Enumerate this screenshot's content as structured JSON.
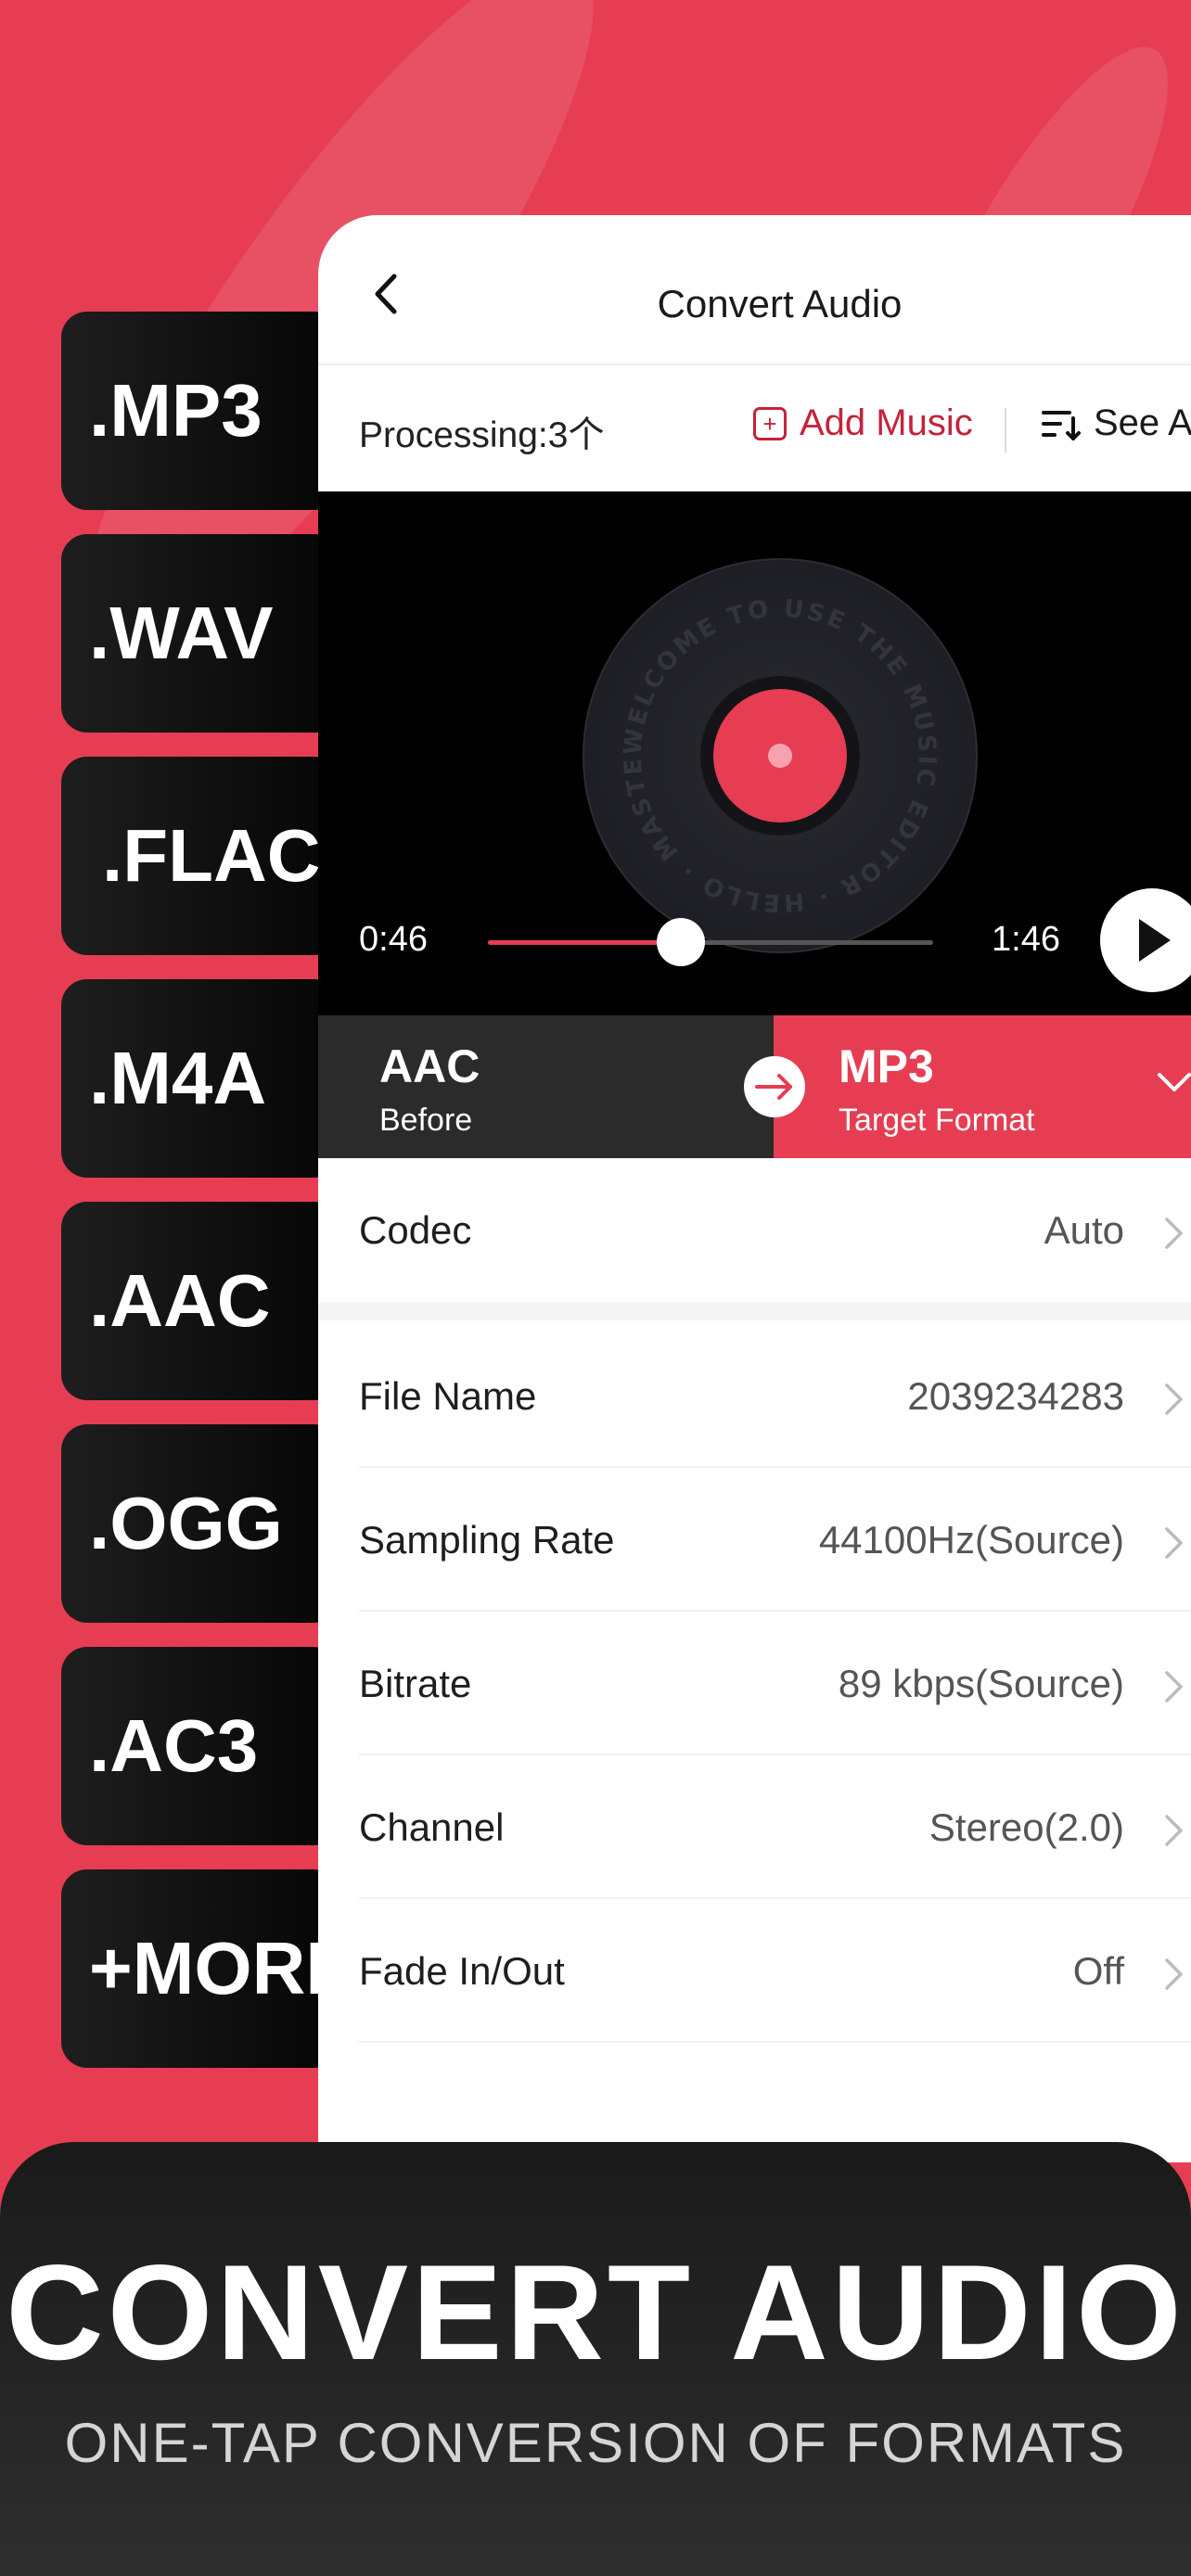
{
  "formats": [
    ".MP3",
    ".WAV",
    ".FLAC",
    ".M4A",
    ".AAC",
    ".OGG",
    ".AC3",
    "+MORE"
  ],
  "nav": {
    "title": "Convert Audio"
  },
  "toolbar": {
    "processing": "Processing:3个",
    "add_music": "Add Music",
    "see_all": "See All"
  },
  "player": {
    "disc_text": "WELCOME TO USE THE MUSIC EDITOR · HELLO · MASTER",
    "current_time": "0:46",
    "total_time": "1:46",
    "progress_fraction": 0.434
  },
  "format_bar": {
    "before_format": "AAC",
    "before_label": "Before",
    "target_format": "MP3",
    "target_label": "Target Format"
  },
  "settings": {
    "codec": {
      "label": "Codec",
      "value": "Auto"
    },
    "rows": [
      {
        "label": "File Name",
        "value": "2039234283"
      },
      {
        "label": "Sampling Rate",
        "value": "44100Hz(Source)"
      },
      {
        "label": "Bitrate",
        "value": "89 kbps(Source)"
      },
      {
        "label": "Channel",
        "value": "Stereo(2.0)"
      },
      {
        "label": "Fade In/Out",
        "value": "Off"
      }
    ]
  },
  "banner": {
    "title": "CONVERT AUDIO",
    "subtitle": "ONE-TAP CONVERSION OF FORMATS"
  },
  "colors": {
    "brand_red": "#e63d53",
    "accent_dark_red": "#c4233a",
    "dark": "#111111"
  }
}
